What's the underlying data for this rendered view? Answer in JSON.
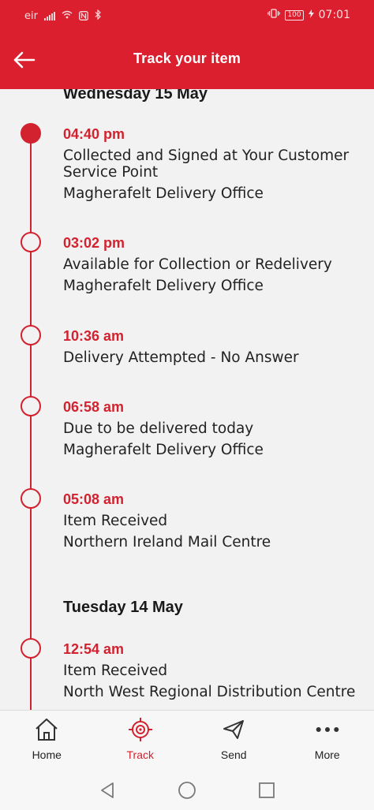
{
  "status_bar": {
    "carrier": "eir",
    "battery": "100",
    "time": "07:01",
    "icons": [
      "signal-icon",
      "wifi-icon",
      "nfc-icon",
      "bluetooth-icon",
      "vibrate-icon",
      "battery-icon",
      "charging-icon"
    ]
  },
  "header": {
    "title": "Track your item",
    "back_icon": "back-arrow-icon"
  },
  "timeline": {
    "days": [
      {
        "date": "Wednesday 15 May",
        "events": [
          {
            "time": "04:40 pm",
            "status": "Collected and Signed at Your Customer Service Point",
            "location": "Magherafelt Delivery Office",
            "current": true
          },
          {
            "time": "03:02 pm",
            "status": "Available for Collection or Redelivery",
            "location": "Magherafelt Delivery Office",
            "current": false
          },
          {
            "time": "10:36 am",
            "status": "Delivery Attempted - No Answer",
            "location": "",
            "current": false
          },
          {
            "time": "06:58 am",
            "status": "Due to be delivered today",
            "location": "Magherafelt Delivery Office",
            "current": false
          },
          {
            "time": "05:08 am",
            "status": "Item Received",
            "location": "Northern Ireland Mail Centre",
            "current": false
          }
        ]
      },
      {
        "date": "Tuesday 14 May",
        "events": [
          {
            "time": "12:54 am",
            "status": "Item Received",
            "location": "North West Regional Distribution Centre",
            "current": false
          }
        ]
      }
    ]
  },
  "bottom_nav": {
    "items": [
      {
        "label": "Home",
        "icon": "home-icon",
        "active": false
      },
      {
        "label": "Track",
        "icon": "target-icon",
        "active": true
      },
      {
        "label": "Send",
        "icon": "paper-plane-icon",
        "active": false
      },
      {
        "label": "More",
        "icon": "more-dots-icon",
        "active": false
      }
    ]
  },
  "system_nav": {
    "icons": [
      "back-triangle-icon",
      "home-circle-icon",
      "recents-square-icon"
    ]
  },
  "colors": {
    "brand_red": "#dc1f2e",
    "accent_red": "#d3222f",
    "background": "#f2f2f2"
  }
}
